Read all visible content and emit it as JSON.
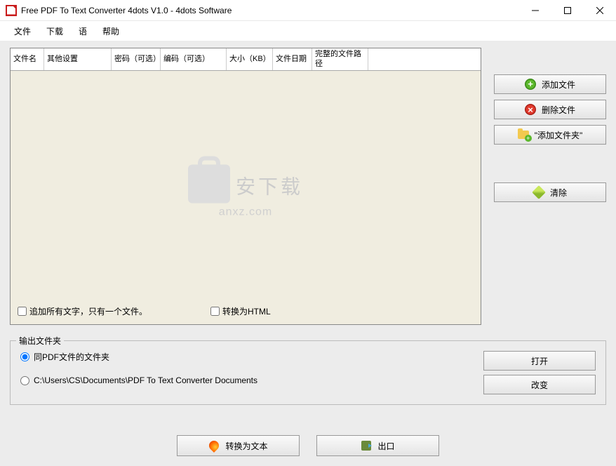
{
  "titlebar": {
    "text": "Free PDF To Text Converter 4dots V1.0 - 4dots Software"
  },
  "menu": {
    "file": "文件",
    "download": "下载",
    "lang": "语",
    "help": "帮助"
  },
  "grid": {
    "columns": {
      "filename": "文件名",
      "other": "其他设置",
      "password": "密码（可选）",
      "encoding": "编码（可选）",
      "size": "大小（KB）",
      "date": "文件日期",
      "path": "完整的文件路径"
    }
  },
  "checks": {
    "append": "追加所有文字，只有一个文件。",
    "tohtml": "转换为HTML"
  },
  "side": {
    "add": "添加文件",
    "remove": "删除文件",
    "addfolder": "\"添加文件夹\"",
    "clear": "清除"
  },
  "group": {
    "title": "输出文件夹",
    "same": "同PDF文件的文件夹",
    "custom": "C:\\Users\\CS\\Documents\\PDF To Text Converter Documents",
    "open": "打开",
    "change": "改变"
  },
  "footer": {
    "convert": "转换为文本",
    "exit": "出口"
  },
  "watermark": {
    "cn": "安下载",
    "en": "anxz.com"
  }
}
